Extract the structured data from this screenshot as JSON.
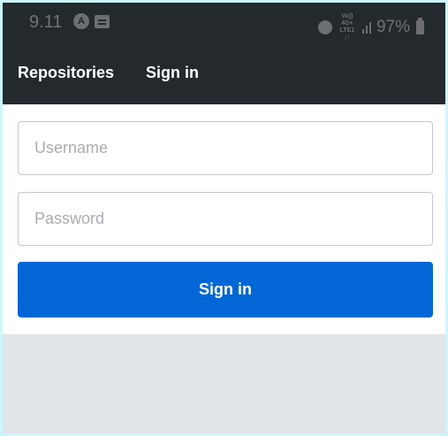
{
  "status_bar": {
    "time": "9.11",
    "left_icons": [
      "notification-app-icon",
      "message-icon"
    ],
    "network_top": "Vo)) 4G+",
    "network_bottom": "LTE1 ↓↑",
    "battery": "97%",
    "icons": [
      "alarm-icon",
      "signal-icon",
      "battery-icon"
    ]
  },
  "nav": {
    "repositories_label": "Repositories",
    "signin_label": "Sign in"
  },
  "form": {
    "username_placeholder": "Username",
    "username_value": "",
    "password_placeholder": "Password",
    "password_value": "",
    "submit_label": "Sign in"
  },
  "colors": {
    "header_bg": "#24292e",
    "primary": "#0366d6",
    "page_bg": "#e1e4e8"
  }
}
